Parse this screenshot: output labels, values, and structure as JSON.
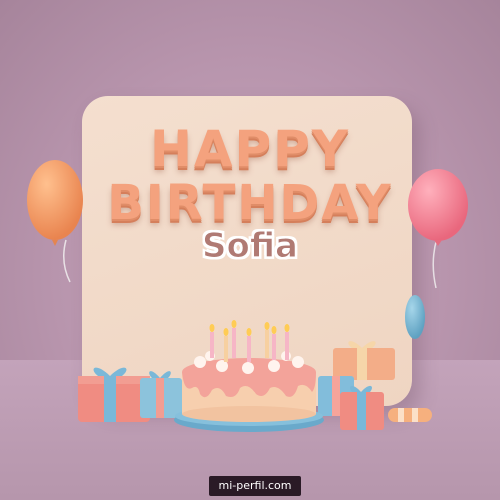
{
  "greeting": {
    "line1": "HAPPY",
    "line2": "BIRTHDAY",
    "name": "Sofia"
  },
  "watermark": "mi-perfil.com",
  "colors": {
    "background": "#b895ad",
    "card": "#f4dfcf",
    "title_text": "#f4a27e",
    "name_text": "#b07a73",
    "balloon_orange": "#f29a64",
    "balloon_pink": "#f07a8e",
    "balloon_blue": "#6fb2cf",
    "cake_frosting": "#f3a39a",
    "gift_pink": "#f08c82",
    "ribbon_blue": "#7ab8d8"
  }
}
